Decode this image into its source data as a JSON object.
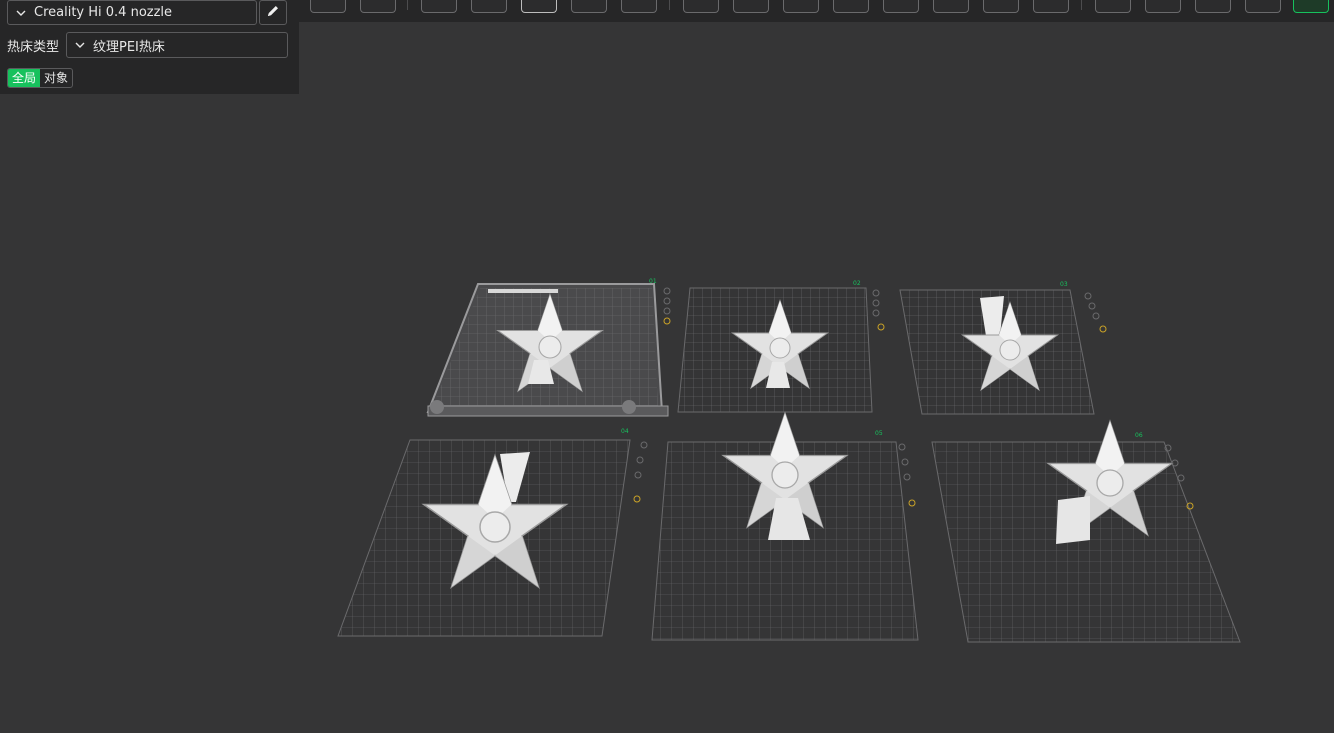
{
  "printer": {
    "selected": "Creality Hi 0.4 nozzle"
  },
  "bed": {
    "label": "热床类型",
    "selected": "纹理PEI热床"
  },
  "mode_tabs": [
    {
      "label": "全局",
      "active": true
    },
    {
      "label": "对象",
      "active": false
    }
  ],
  "plates": [
    {
      "number": "01",
      "active": true,
      "model": "star-ornament"
    },
    {
      "number": "02",
      "active": false,
      "model": "star-ornament"
    },
    {
      "number": "03",
      "active": false,
      "model": "star-ornament"
    },
    {
      "number": "04",
      "active": false,
      "model": "star-ornament"
    },
    {
      "number": "05",
      "active": false,
      "model": "star-ornament"
    },
    {
      "number": "06",
      "active": false,
      "model": "star-ornament"
    }
  ],
  "colors": {
    "accent": "#17c15d",
    "panel_bg": "#262627",
    "scene_bg": "#353536",
    "grid": "#6e6e70",
    "model": "#e4e4e4"
  }
}
